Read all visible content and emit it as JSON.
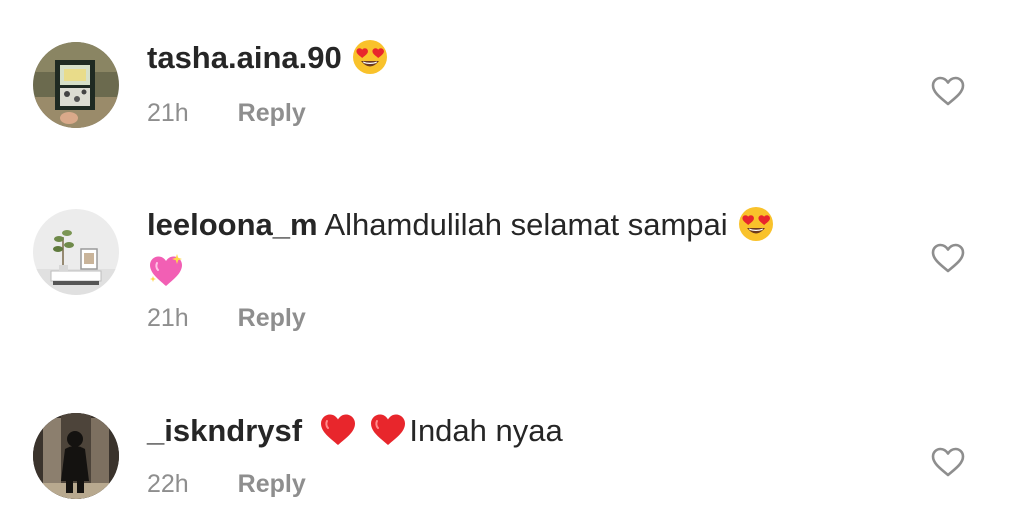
{
  "comments": [
    {
      "username": "tasha.aina.90",
      "text": "",
      "emojis": [
        "heart-eyes-emoji"
      ],
      "time": "21h",
      "reply_label": "Reply"
    },
    {
      "username": "leeloona_m",
      "text": "Alhamdulilah selamat sampai",
      "emojis": [
        "heart-eyes-emoji",
        "sparkling-heart-emoji"
      ],
      "time": "21h",
      "reply_label": "Reply"
    },
    {
      "username": "_iskndrysf",
      "text": "Indah nyaa",
      "emojis": [
        "red-heart-emoji",
        "red-heart-emoji"
      ],
      "time": "22h",
      "reply_label": "Reply"
    }
  ],
  "colors": {
    "text": "#262626",
    "secondary": "#8e8e8e",
    "heart_red": "#e8262c",
    "emoji_yellow": "#f9c22b"
  }
}
